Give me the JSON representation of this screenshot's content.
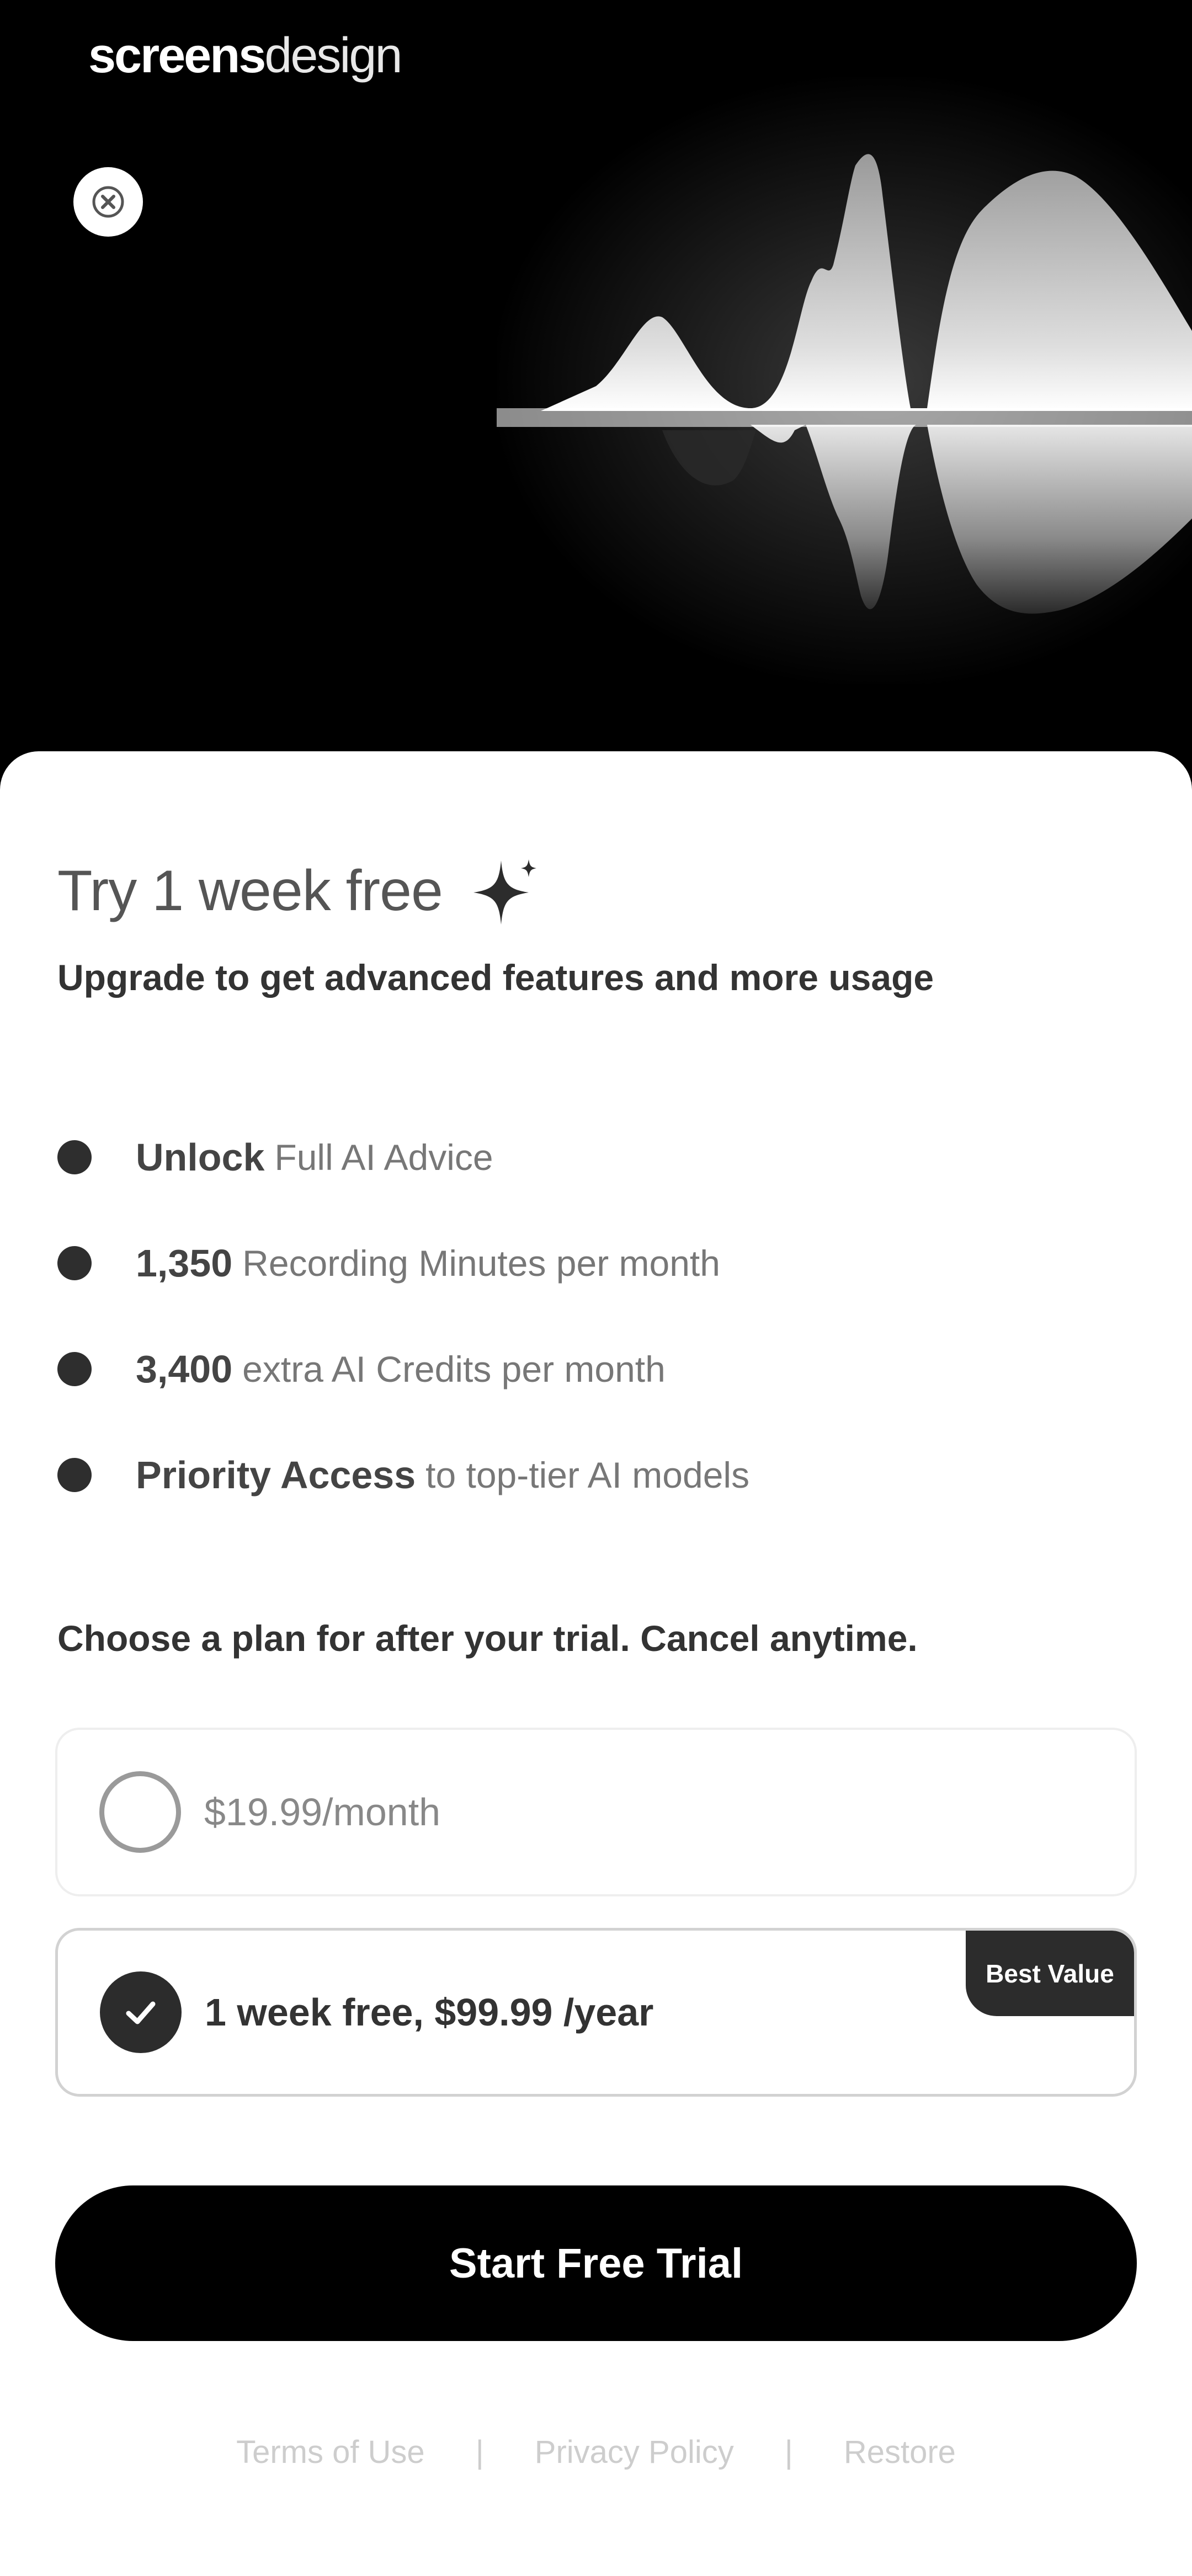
{
  "brand": {
    "part1": "screens",
    "part2": "design"
  },
  "header": {
    "close_icon": "close-icon"
  },
  "hero": {
    "art": "audio-waveform-graphic"
  },
  "trial": {
    "title": "Try 1 week free",
    "title_icon": "sparkle-icon",
    "subtitle": "Upgrade to get advanced features and more usage"
  },
  "features": [
    {
      "strong": "Unlock",
      "rest": "Full AI Advice"
    },
    {
      "strong": "1,350",
      "rest": "Recording Minutes per month"
    },
    {
      "strong": "3,400",
      "rest": "extra AI Credits per month"
    },
    {
      "strong": "Priority Access",
      "rest": "to top-tier AI models"
    }
  ],
  "plans": {
    "heading": "Choose a plan for after your trial. Cancel anytime.",
    "options": [
      {
        "label": "$19.99/month",
        "selected": false
      },
      {
        "label": "1 week free, $99.99 /year",
        "selected": true,
        "badge": "Best Value"
      }
    ]
  },
  "cta": {
    "label": "Start Free Trial"
  },
  "footer": {
    "links": [
      "Terms of Use",
      "Privacy Policy",
      "Restore"
    ],
    "separator": "|"
  },
  "colors": {
    "background": "#000000",
    "sheet": "#ffffff",
    "accent": "#2c2c2c",
    "cta": "#000000"
  }
}
